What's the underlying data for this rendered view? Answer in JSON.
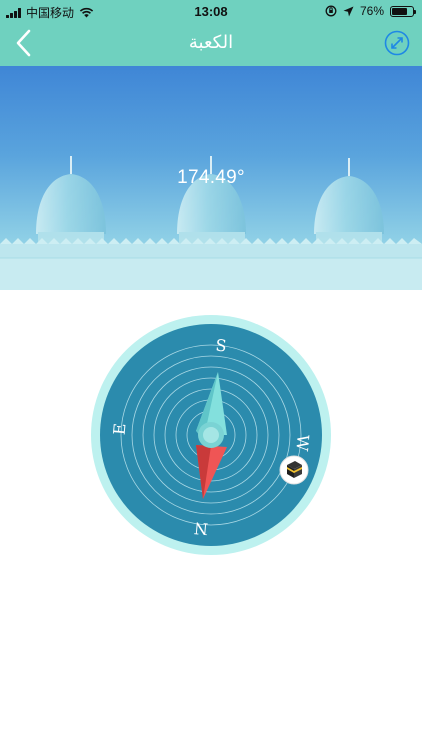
{
  "status_bar": {
    "carrier": "中国移动",
    "time": "13:08",
    "battery_percent": "76%",
    "battery_level": 0.76
  },
  "nav": {
    "title": "الكعبة"
  },
  "hero": {
    "degree": "174.49°"
  },
  "compass": {
    "labels": {
      "top": "S",
      "bottom": "N",
      "left": "E",
      "right": "W"
    },
    "heading_degrees": 174.49
  },
  "colors": {
    "header": "#6fd1bf",
    "compass_outer": "#bdf1ef",
    "compass_face": "#2b8bad",
    "needle_north": "#ef5555",
    "needle_south": "#83e0dd",
    "accent_blue": "#1e88e5"
  },
  "icons": {
    "back": "chevron-left-icon",
    "calibrate": "expand-arrows-icon",
    "kaaba": "kaaba-icon",
    "wifi": "wifi-icon",
    "location": "location-arrow-icon",
    "orientation_lock": "orientation-lock-icon"
  }
}
